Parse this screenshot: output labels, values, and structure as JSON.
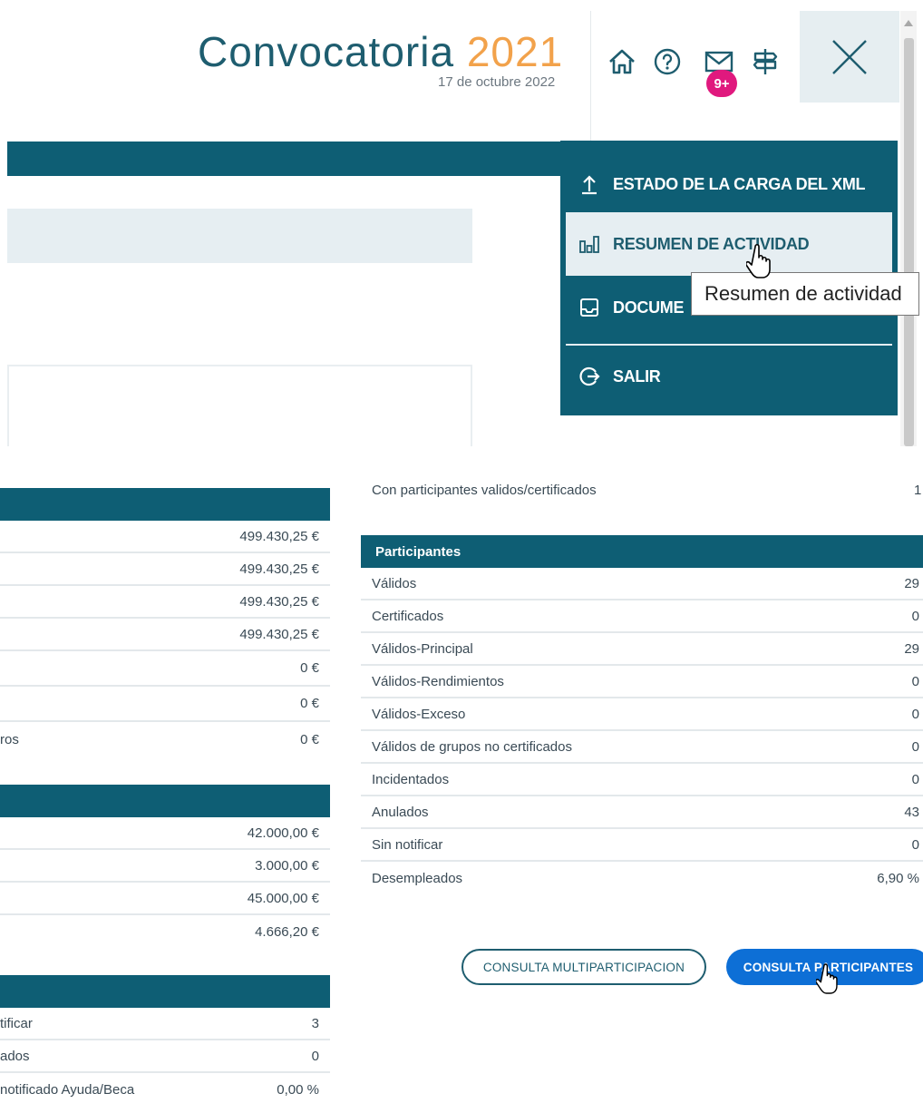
{
  "header": {
    "title": "Convocatoria",
    "year": "2021",
    "date": "17 de octubre 2022",
    "icons": [
      "home-icon",
      "help-icon",
      "mail-icon",
      "signpost-icon"
    ],
    "mail_badge": "9+",
    "close_icon": "close-icon"
  },
  "menu": {
    "items": [
      {
        "label": "ESTADO DE LA CARGA DEL XML",
        "icon": "upload-icon"
      },
      {
        "label": "RESUMEN DE ACTIVIDAD",
        "icon": "bar-chart-icon"
      },
      {
        "label": "DOCUME",
        "icon": "tray-icon"
      },
      {
        "label": "SALIR",
        "icon": "logout-icon"
      }
    ],
    "tooltip": "Resumen de actividad"
  },
  "left_panel": {
    "section1": {
      "rows": [
        {
          "label": "",
          "value": "499.430,25 €"
        },
        {
          "label": "",
          "value": "499.430,25 €"
        },
        {
          "label": "",
          "value": "499.430,25 €"
        },
        {
          "label": "",
          "value": "499.430,25 €"
        },
        {
          "label": "",
          "value": "0 €"
        },
        {
          "label": "",
          "value": "0 €"
        },
        {
          "label": "ros",
          "value": "0 €"
        }
      ]
    },
    "section2": {
      "rows": [
        {
          "label": "",
          "value": "42.000,00 €"
        },
        {
          "label": "",
          "value": "3.000,00 €"
        },
        {
          "label": "",
          "value": "45.000,00 €"
        },
        {
          "label": "",
          "value": "4.666,20 €"
        }
      ]
    },
    "section3": {
      "rows": [
        {
          "label": "tificar",
          "value": "3"
        },
        {
          "label": "ados",
          "value": "0"
        },
        {
          "label": "notificado Ayuda/Beca",
          "value": "0,00 %"
        }
      ]
    }
  },
  "right_panel": {
    "top_row": {
      "label": "Con participantes validos/certificados",
      "value": "1"
    },
    "section_title": "Participantes",
    "rows": [
      {
        "label": "Válidos",
        "value": "29"
      },
      {
        "label": "Certificados",
        "value": "0"
      },
      {
        "label": "Válidos-Principal",
        "value": "29"
      },
      {
        "label": "Válidos-Rendimientos",
        "value": "0"
      },
      {
        "label": "Válidos-Exceso",
        "value": "0"
      },
      {
        "label": "Válidos de grupos no certificados",
        "value": "0"
      },
      {
        "label": "Incidentados",
        "value": "0"
      },
      {
        "label": "Anulados",
        "value": "43"
      },
      {
        "label": "Sin notificar",
        "value": "0"
      },
      {
        "label": "Desempleados",
        "value": "6,90 %"
      }
    ]
  },
  "buttons": {
    "multiparticipacion": "CONSULTA MULTIPARTICIPACION",
    "participantes": "CONSULTA PARTICIPANTES"
  },
  "colors": {
    "teal": "#0e5e74",
    "orange": "#f2a24b",
    "badge": "#e0197e",
    "primary_button": "#0d6fd6"
  }
}
